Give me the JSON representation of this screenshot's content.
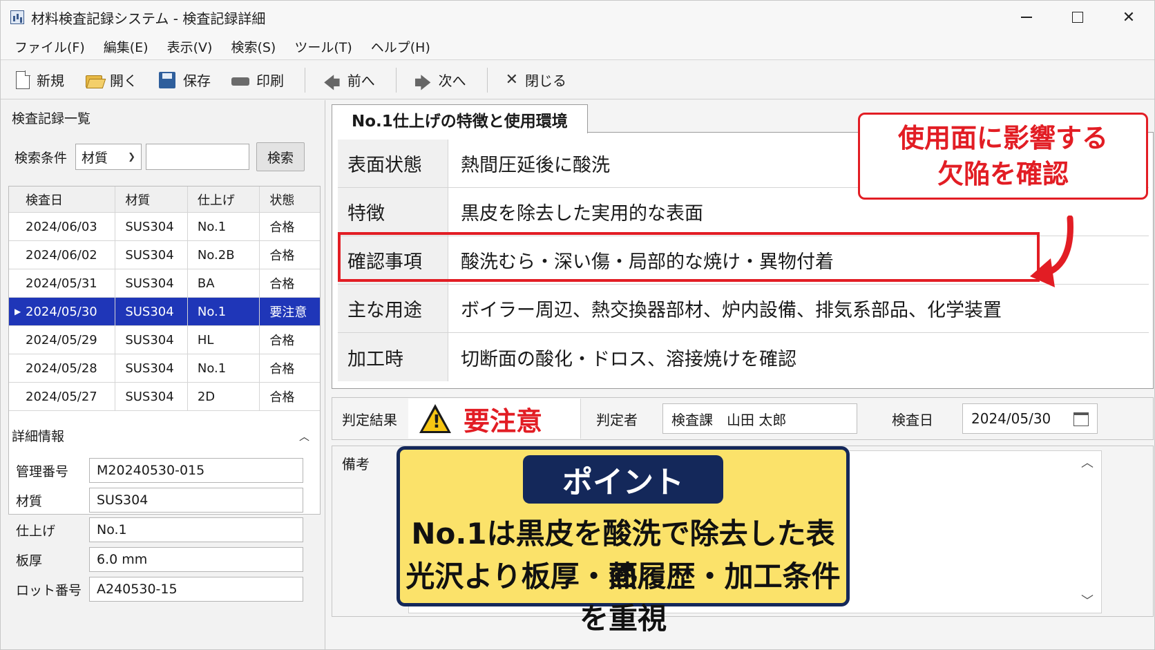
{
  "window": {
    "title": "材料検査記録システム - 検査記録詳細",
    "controls": {
      "minimize": "",
      "maximize": "",
      "close": "✕"
    }
  },
  "menu": [
    "ファイル(F)",
    "編集(E)",
    "表示(V)",
    "検索(S)",
    "ツール(T)",
    "ヘルプ(H)"
  ],
  "toolbar": {
    "new": "新規",
    "open": "開く",
    "save": "保存",
    "print": "印刷",
    "prev": "前へ",
    "next": "次へ",
    "close": "閉じる"
  },
  "records": {
    "title": "検査記録一覧",
    "search_label": "検索条件",
    "search_field": "材質",
    "search_value": "",
    "search_button": "検索",
    "columns": [
      "検査日",
      "材質",
      "仕上げ",
      "状態"
    ],
    "rows": [
      [
        "2024/06/03",
        "SUS304",
        "No.1",
        "合格"
      ],
      [
        "2024/06/02",
        "SUS304",
        "No.2B",
        "合格"
      ],
      [
        "2024/05/31",
        "SUS304",
        "BA",
        "合格"
      ],
      [
        "2024/05/30",
        "SUS304",
        "No.1",
        "要注意"
      ],
      [
        "2024/05/29",
        "SUS304",
        "HL",
        "合格"
      ],
      [
        "2024/05/28",
        "SUS304",
        "No.1",
        "合格"
      ],
      [
        "2024/05/27",
        "SUS304",
        "2D",
        "合格"
      ]
    ],
    "selected_index": 3
  },
  "detail": {
    "title": "詳細情報",
    "fields": [
      {
        "label": "管理番号",
        "value": "M20240530-015"
      },
      {
        "label": "材質",
        "value": "SUS304"
      },
      {
        "label": "仕上げ",
        "value": "No.1"
      },
      {
        "label": "板厚",
        "value": "6.0 mm"
      },
      {
        "label": "ロット番号",
        "value": "A240530-15"
      }
    ]
  },
  "tab": {
    "title": "No.1仕上げの特徴と使用環境",
    "properties": [
      {
        "key": "表面状態",
        "value": "熱間圧延後に酸洗"
      },
      {
        "key": "特徴",
        "value": "黒皮を除去した実用的な表面"
      },
      {
        "key": "確認事項",
        "value": "酸洗むら・深い傷・局部的な焼け・異物付着"
      },
      {
        "key": "主な用途",
        "value": "ボイラー周辺、熱交換器部材、炉内設備、排気系部品、化学装置"
      },
      {
        "key": "加工時",
        "value": "切断面の酸化・ドロス、溶接焼けを確認"
      }
    ]
  },
  "callout": {
    "line1": "使用面に影響する",
    "line2": "欠陥を確認"
  },
  "judgement": {
    "result_label": "判定結果",
    "result_value": "要注意",
    "judge_label": "判定者",
    "judge_value": "検査課　山田 太郎",
    "date_label": "検査日",
    "date_value": "2024/05/30"
  },
  "remarks": {
    "label": "備考",
    "point_title": "ポイント",
    "point_line1": "No.1は黒皮を酸洗で除去した表面",
    "point_line2": "光沢より板厚・熱履歴・加工条件を重視"
  },
  "colors": {
    "accent_red": "#e21d24",
    "selection_blue": "#1f36b8",
    "point_yellow": "#fbe26a",
    "point_navy": "#14285a"
  }
}
